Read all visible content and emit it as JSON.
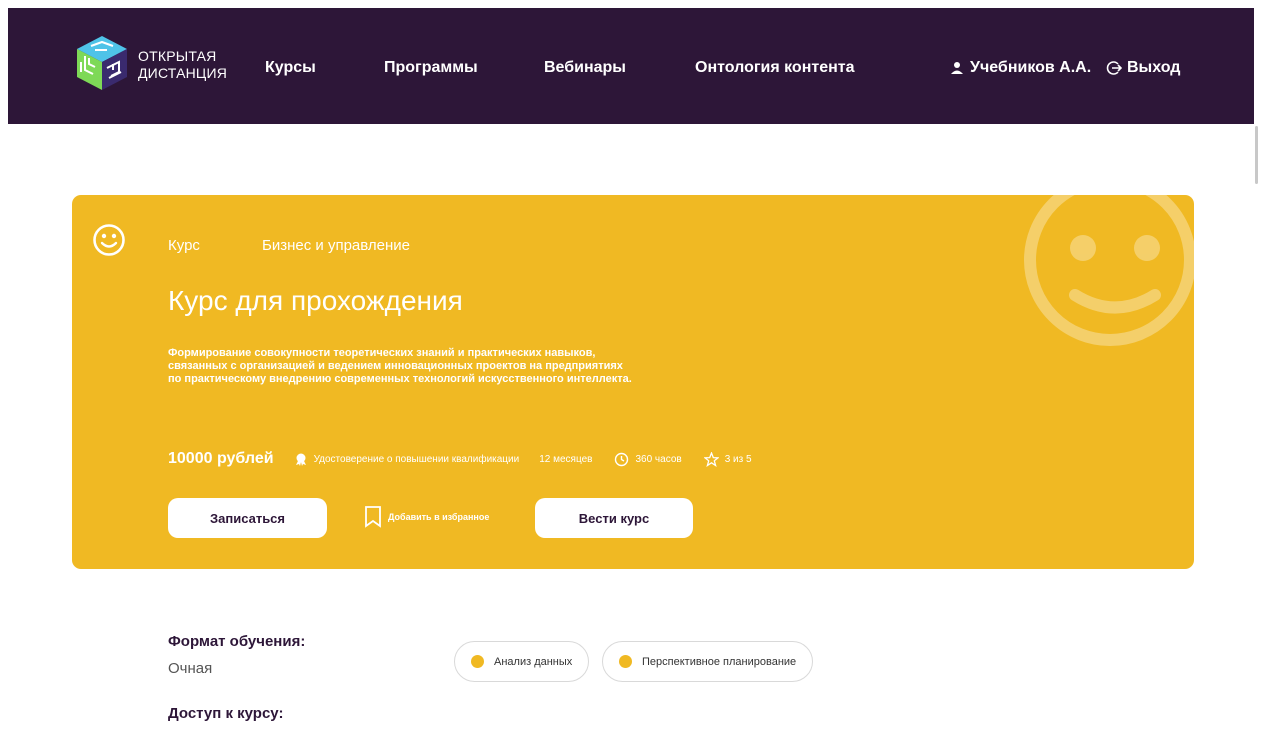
{
  "header": {
    "logo_line1": "ОТКРЫТАЯ",
    "logo_line2": "ДИСТАНЦИЯ",
    "nav": [
      "Курсы",
      "Программы",
      "Вебинары",
      "Онтология контента"
    ],
    "user_name": "Учебников А.А.",
    "logout": "Выход"
  },
  "course": {
    "tag_type": "Курс",
    "tag_category": "Бизнес и управление",
    "title": "Курс для прохождения",
    "description": "Формирование совокупности теоретических знаний и практических навыков, связанных с организацией и ведением инновационных проектов на предприятиях по практическому внедрению современных технологий искусственного интеллекта.",
    "price": "10000 рублей",
    "certificate": "Удостоверение о повышении квалификации",
    "duration": "12 месяцев",
    "hours": "360 часов",
    "rating": "3 из 5",
    "enroll_label": "Записаться",
    "favorite_label": "Добавить в избранное",
    "teach_label": "Вести курс"
  },
  "details": {
    "format_label": "Формат обучения:",
    "format_value": "Очная",
    "access_label": "Доступ к курсу:",
    "skills": [
      "Анализ данных",
      "Перспективное планирование"
    ]
  },
  "colors": {
    "header_bg": "#2d1638",
    "accent": "#f0b923",
    "text_dark": "#2d1638"
  }
}
